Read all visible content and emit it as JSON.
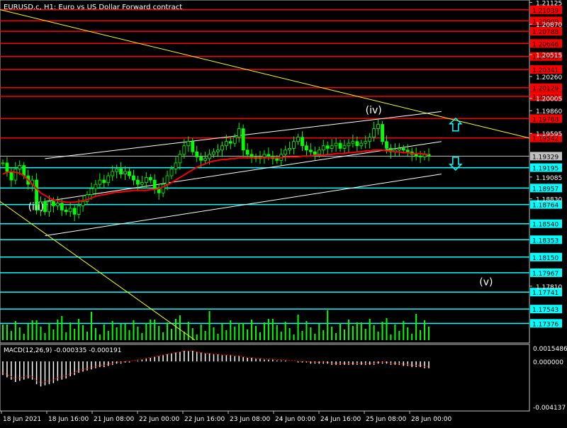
{
  "header": {
    "symbol_title": "EURUSD.c, H1:  Euro vs US Dollar Forward contract"
  },
  "macd": {
    "label": "MACD(12,26,9) -0.000335 -0.000191",
    "axis_labels": [
      "0.0015486",
      "0.000000",
      "-0.004137"
    ]
  },
  "colors": {
    "background": "#000000",
    "candle": "#00ff00",
    "resistance": "#ff0000",
    "support": "#00ffff",
    "trend_white": "#ffffff",
    "trend_yellow": "#ffff00",
    "moving_average": "#ff0000",
    "current_price": "#c0c0c0"
  },
  "chart_data": {
    "type": "candlestick",
    "symbol": "EURUSD.c",
    "timeframe": "H1",
    "ylim": [
      1.1718,
      1.2112
    ],
    "y_ticks": [
      "1.21125",
      "1.20870",
      "1.20515",
      "1.20260",
      "1.20005",
      "1.19860",
      "1.19595",
      "1.19085",
      "1.18830",
      "1.17810"
    ],
    "x_ticks": [
      "18 Jun 2021",
      "18 Jun 16:00",
      "21 Jun 08:00",
      "22 Jun 00:00",
      "22 Jun 16:00",
      "23 Jun 08:00",
      "24 Jun 00:00",
      "24 Jun 16:00",
      "25 Jun 08:00",
      "28 Jun 00:00"
    ],
    "resistance_levels": [
      "1.21039",
      "1.20909",
      "1.20788",
      "1.20646",
      "1.20493",
      "1.20341",
      "1.20129",
      "1.20027",
      "1.19768",
      "1.19542"
    ],
    "support_levels": [
      "1.19195",
      "1.18957",
      "1.18764",
      "1.18540",
      "1.18353",
      "1.18150",
      "1.17967",
      "1.17741",
      "1.17543",
      "1.17376"
    ],
    "current_price": "1.19329",
    "wave_labels": [
      {
        "text": "(iii)",
        "bar": 8,
        "price": 1.187
      },
      {
        "text": "(iv)",
        "bar": 88,
        "price": 1.1983
      },
      {
        "text": "(v)",
        "bar": 115,
        "price": 1.1782
      }
    ],
    "arrows": [
      {
        "direction": "up",
        "bar": 104,
        "price": 1.1969
      },
      {
        "direction": "down",
        "bar": 104,
        "price": 1.1925
      }
    ],
    "close": [
      1.1925,
      1.1915,
      1.1905,
      1.1918,
      1.1922,
      1.191,
      1.19,
      1.1905,
      1.187,
      1.188,
      1.1868,
      1.188,
      1.1875,
      1.1878,
      1.187,
      1.1868,
      1.1872,
      1.1865,
      1.1875,
      1.188,
      1.1888,
      1.1895,
      1.19,
      1.1905,
      1.1902,
      1.191,
      1.1915,
      1.1918,
      1.1912,
      1.1915,
      1.191,
      1.1905,
      1.19,
      1.1902,
      1.1908,
      1.1905,
      1.1895,
      1.189,
      1.19,
      1.191,
      1.1918,
      1.1925,
      1.1935,
      1.1945,
      1.195,
      1.1938,
      1.1932,
      1.1928,
      1.193,
      1.1935,
      1.1938,
      1.194,
      1.1945,
      1.195,
      1.1948,
      1.1955,
      1.1965,
      1.194,
      1.1935,
      1.1932,
      1.193,
      1.1932,
      1.1935,
      1.1933,
      1.193,
      1.1928,
      1.1935,
      1.194,
      1.1942,
      1.195,
      1.1955,
      1.1945,
      1.194,
      1.1938,
      1.1935,
      1.194,
      1.1945,
      1.1942,
      1.1945,
      1.1948,
      1.1942,
      1.1945,
      1.1948,
      1.195,
      1.1945,
      1.1948,
      1.195,
      1.1955,
      1.1965,
      1.197,
      1.195,
      1.1942,
      1.1938,
      1.194,
      1.1942,
      1.194,
      1.1938,
      1.1935,
      1.1933,
      1.1932,
      1.1935,
      1.1933
    ],
    "moving_average": [
      1.1912,
      1.1914,
      1.1915,
      1.1914,
      1.1913,
      1.191,
      1.1905,
      1.19,
      1.1895,
      1.189,
      1.1887,
      1.1884,
      1.1882,
      1.1881,
      1.188,
      1.1879,
      1.1879,
      1.1879,
      1.188,
      1.1881,
      1.1882,
      1.1884,
      1.1886,
      1.1887,
      1.1888,
      1.1889,
      1.189,
      1.1891,
      1.1891,
      1.1892,
      1.1892,
      1.1893,
      1.1893,
      1.1893,
      1.1893,
      1.1894,
      1.1894,
      1.1895,
      1.1897,
      1.1899,
      1.1902,
      1.1905,
      1.1908,
      1.1911,
      1.1914,
      1.1917,
      1.192,
      1.1922,
      1.1924,
      1.1926,
      1.1927,
      1.1928,
      1.1929,
      1.1929,
      1.193,
      1.193,
      1.1931,
      1.1931,
      1.1931,
      1.1931,
      1.1931,
      1.1931,
      1.1931,
      1.1931,
      1.1931,
      1.1931,
      1.1931,
      1.1932,
      1.1932,
      1.1932,
      1.1932,
      1.1933,
      1.1933,
      1.1933,
      1.1934,
      1.1934,
      1.1934,
      1.1935,
      1.1935,
      1.1936,
      1.1936,
      1.1936,
      1.1937,
      1.1937,
      1.1938,
      1.1938,
      1.1939,
      1.1939,
      1.194,
      1.194,
      1.194,
      1.1939,
      1.1939,
      1.1938,
      1.1938,
      1.1937,
      1.1937,
      1.1936,
      1.1936,
      1.1936,
      1.1935,
      1.1935
    ],
    "macd_histogram": [
      -0.0012,
      -0.0014,
      -0.0016,
      -0.0018,
      -0.0017,
      -0.0016,
      -0.0015,
      -0.0016,
      -0.002,
      -0.0022,
      -0.0021,
      -0.002,
      -0.0019,
      -0.0017,
      -0.0016,
      -0.0015,
      -0.0013,
      -0.0012,
      -0.001,
      -0.0009,
      -0.0008,
      -0.0007,
      -0.0006,
      -0.0005,
      -0.0005,
      -0.0004,
      -0.0003,
      -0.0002,
      -0.0002,
      -0.0001,
      -0.0001,
      0.0,
      0.0001,
      0.0002,
      0.0003,
      0.0004,
      0.0005,
      0.0006,
      0.0007,
      0.0008,
      0.0009,
      0.001,
      0.0011,
      0.0012,
      0.0012,
      0.0012,
      0.0011,
      0.001,
      0.0009,
      0.0009,
      0.0008,
      0.0008,
      0.0007,
      0.0007,
      0.0007,
      0.0006,
      0.0006,
      0.0005,
      0.0004,
      0.0004,
      0.0003,
      0.0003,
      0.0002,
      0.0002,
      0.0002,
      0.0001,
      0.0001,
      0.0001,
      0.0,
      0.0,
      -0.0001,
      -0.0001,
      -0.0001,
      -0.0002,
      -0.0002,
      -0.0002,
      -0.0002,
      -0.0002,
      -0.0003,
      -0.0003,
      -0.0003,
      -0.0003,
      -0.0003,
      -0.0003,
      -0.0003,
      -0.0003,
      -0.0003,
      -0.0003,
      -0.0003,
      -0.0002,
      -0.0002,
      -0.0002,
      -0.0003,
      -0.0003,
      -0.0003,
      -0.0004,
      -0.0004,
      -0.0005,
      -0.0005,
      -0.0005,
      -0.0006,
      -0.0006
    ],
    "macd_ylim": [
      -0.0041,
      0.0016
    ]
  }
}
